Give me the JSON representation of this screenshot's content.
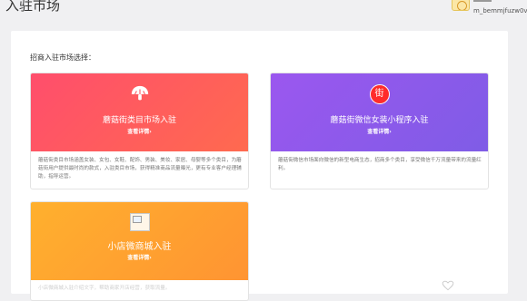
{
  "header": {
    "title": "入驻市场",
    "user": {
      "name": "m_bemmjfuzw0v"
    }
  },
  "main": {
    "section_label": "招商入驻市场选择：",
    "cards": [
      {
        "icon": "mushroom-icon",
        "title": "蘑菇街类目市场入驻",
        "link": "查看详情›",
        "description": "蘑菇街类目市场涵盖女装、女包、女鞋、配饰、男装、美妆、家居、母婴等多个类目，为蘑菇街用户提供最时尚的款式，入驻类目市场，获得精准商品流量曝光，更有专业客户经理辅助，指导运营。",
        "accent": "#ff4e6c"
      },
      {
        "icon": "jie-badge-icon",
        "icon_text": "街",
        "title": "蘑菇街微信女装小程序入驻",
        "link": "查看详情›",
        "description": "蘑菇街微信市场面向微信的新型电商生态，招商多个类目，享受微信千万流量带来的流量红利。",
        "accent": "#8f5aea"
      },
      {
        "icon": "broken-image-icon",
        "title": "小店微商城入驻",
        "link": "查看详情›",
        "description": "小店微商城入驻介绍文字，帮助商家开店经营，获取流量。",
        "accent": "#ffa530"
      }
    ]
  },
  "decor": {
    "bottom_icon": "heart-outline-icon"
  }
}
